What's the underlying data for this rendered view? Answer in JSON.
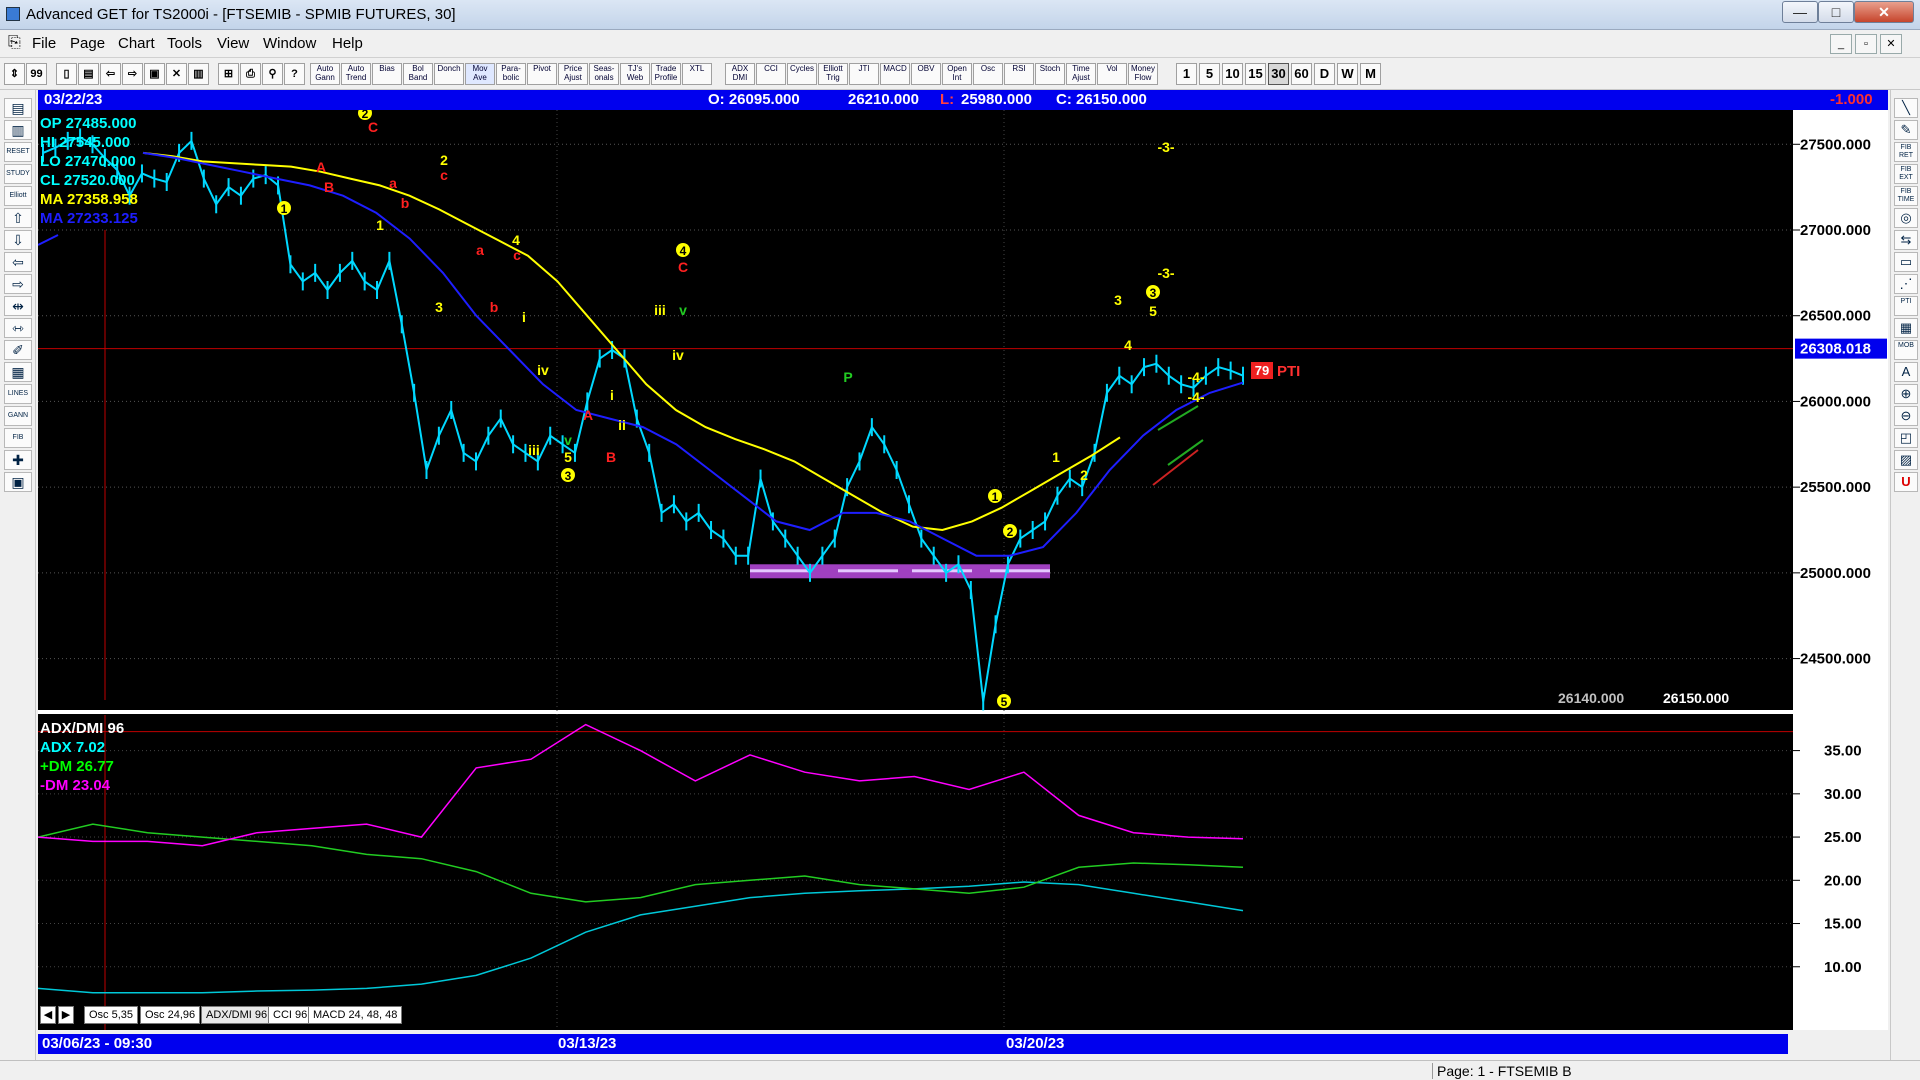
{
  "window": {
    "title": "Advanced GET for TS2000i - [FTSEMIB - SPMIB FUTURES, 30]",
    "minimize": "—",
    "maximize": "□",
    "close": "✕"
  },
  "menu": [
    "File",
    "Page",
    "Chart",
    "Tools",
    "View",
    "Window",
    "Help"
  ],
  "toolbar": {
    "studies": [
      "Auto Gann",
      "Auto Trend",
      "Bias",
      "Bol Band",
      "Donch",
      "Mov Ave",
      "Para-bolic",
      "Pivot",
      "Price Ajust",
      "Seas-onals",
      "TJ's Web",
      "Trade Profile",
      "XTL",
      "ADX DMI",
      "CCI",
      "Cycles",
      "Elliott Trig",
      "JTI",
      "MACD",
      "OBV",
      "Open Int",
      "Osc",
      "RSI",
      "Stoch",
      "Time Ajust",
      "Vol",
      "Money Flow"
    ],
    "frames": [
      "1",
      "5",
      "10",
      "15",
      "30",
      "60",
      "D",
      "W",
      "M"
    ],
    "selected_frame": "30"
  },
  "left_tools": [
    "▤",
    "▥",
    "RESET",
    "STUDY",
    "Elliott",
    "⇧",
    "⇩",
    "⇦",
    "⇨",
    "⇹",
    "⇿",
    "✐",
    "▦",
    "LINES",
    "GANN",
    "FIB",
    "✚",
    "▣"
  ],
  "right_tools": [
    "╲",
    "✎",
    "FIB RET",
    "FIB EXT",
    "FIB TIME",
    "◎",
    "⇆",
    "▭",
    "⋰",
    "PTI",
    "▦",
    "MOB",
    "A",
    "⊕",
    "⊖",
    "◰",
    "▨",
    "U"
  ],
  "header": {
    "date": "03/22/23",
    "open": "O: 26095.000",
    "high": "26210.000",
    "low_label": "L:",
    "low_value": "25980.000",
    "close": "C: 26150.000",
    "change": "-1.000"
  },
  "info_panel": [
    {
      "label": "OP 27485.000",
      "color": "#00ffff"
    },
    {
      "label": "HI  27545.000",
      "color": "#00ffff"
    },
    {
      "label": "LO  27470.000",
      "color": "#00ffff"
    },
    {
      "label": "CL  27520.000",
      "color": "#00ffff"
    },
    {
      "label": "MA  27358.958",
      "color": "#ffff00"
    },
    {
      "label": "MA  27233.125",
      "color": "#1e1eff"
    }
  ],
  "price_axis": {
    "ticks": [
      "27500.000",
      "27000.000",
      "26500.000",
      "26000.000",
      "25500.000",
      "25000.000",
      "24500.000"
    ],
    "current": "26308.018"
  },
  "bottom_values": [
    "26140.000",
    "26150.000"
  ],
  "pti": {
    "value": "79",
    "label": "PTI"
  },
  "indicator": {
    "legend": [
      {
        "label": "ADX/DMI 96",
        "color": "#ffffff"
      },
      {
        "label": "ADX 7.02",
        "color": "#00ffff"
      },
      {
        "label": "+DM 26.77",
        "color": "#00ff00"
      },
      {
        "label": "-DM  23.04",
        "color": "#ff00ff"
      }
    ],
    "ticks": [
      "35.00",
      "30.00",
      "25.00",
      "20.00",
      "15.00",
      "10.00"
    ]
  },
  "tabs": [
    "Osc 5,35",
    "Osc 24,96",
    "ADX/DMI 96",
    "CCI 96",
    "MACD 24, 48, 48"
  ],
  "dates": [
    "03/06/23 - 09:30",
    "03/13/23",
    "03/20/23"
  ],
  "status": "Page: 1 - FTSEMIB B",
  "colors": {
    "background": "#000000",
    "price": "#00d8ff",
    "ma_fast": "#ffff00",
    "ma_slow": "#1e1eff",
    "adx": "#00c8d8",
    "plus_dm": "#22cc22",
    "minus_dm": "#ff00ff",
    "crosshair": "#c00000",
    "band": "#a040c0"
  },
  "chart_data": {
    "type": "line",
    "symbol": "FTSEMIB - SPMIB FUTURES",
    "interval": "30",
    "ylim": [
      24200,
      27700
    ],
    "price": [
      27450,
      27480,
      27520,
      27540,
      27500,
      27420,
      27350,
      27200,
      27330,
      27300,
      27280,
      27450,
      27520,
      27300,
      27150,
      27250,
      27200,
      27300,
      27320,
      27260,
      26800,
      26700,
      26750,
      26650,
      26750,
      26820,
      26700,
      26650,
      26820,
      26450,
      26050,
      25600,
      25800,
      25950,
      25700,
      25650,
      25800,
      25900,
      25750,
      25700,
      25650,
      25800,
      25750,
      25700,
      26000,
      26250,
      26300,
      26250,
      25900,
      25700,
      25350,
      25400,
      25300,
      25350,
      25250,
      25200,
      25100,
      25100,
      25550,
      25300,
      25200,
      25100,
      25000,
      25100,
      25200,
      25500,
      25650,
      25850,
      25750,
      25600,
      25400,
      25200,
      25100,
      25000,
      25050,
      24900,
      24250,
      24700,
      25050,
      25200,
      25250,
      25300,
      25450,
      25550,
      25500,
      25700,
      26050,
      26150,
      26100,
      26200,
      26220,
      26150,
      26100,
      26080,
      26150,
      26200,
      26180,
      26150
    ],
    "ma_fast": [
      27450,
      27430,
      27400,
      27390,
      27380,
      27370,
      27340,
      27300,
      27260,
      27200,
      27120,
      27030,
      26940,
      26850,
      26700,
      26500,
      26300,
      26100,
      25950,
      25850,
      25780,
      25720,
      25650,
      25550,
      25450,
      25350,
      25270,
      25250,
      25300,
      25380,
      25480,
      25580,
      25680,
      25790
    ],
    "ma_slow": [
      27450,
      27420,
      27380,
      27340,
      27300,
      27260,
      27200,
      27100,
      26950,
      26750,
      26500,
      26300,
      26100,
      25950,
      25900,
      25850,
      25750,
      25600,
      25450,
      25300,
      25250,
      25350,
      25350,
      25300,
      25200,
      25100,
      25100,
      25150,
      25350,
      25600,
      25800,
      25950,
      26050,
      26110
    ],
    "adx_dmi": {
      "adx": [
        7.5,
        7,
        7,
        7,
        7.2,
        7.3,
        7.5,
        8,
        9,
        11,
        14,
        16,
        17,
        18,
        18.5,
        18.8,
        19,
        19.3,
        19.8,
        19.5,
        18.5,
        17.5,
        16.5
      ],
      "plus_dm": [
        25,
        26.5,
        25.5,
        25,
        24.5,
        24,
        23,
        22.5,
        21,
        18.5,
        17.5,
        18,
        19.5,
        20,
        20.5,
        19.5,
        19,
        18.5,
        19.2,
        21.5,
        22,
        21.8,
        21.5
      ],
      "minus_dm": [
        25,
        24.5,
        24.5,
        24,
        25.5,
        26,
        26.5,
        25,
        33,
        34,
        38,
        35,
        31.5,
        34.5,
        32.5,
        31.5,
        32,
        30.5,
        32.5,
        27.5,
        25.5,
        25,
        24.8
      ]
    }
  }
}
